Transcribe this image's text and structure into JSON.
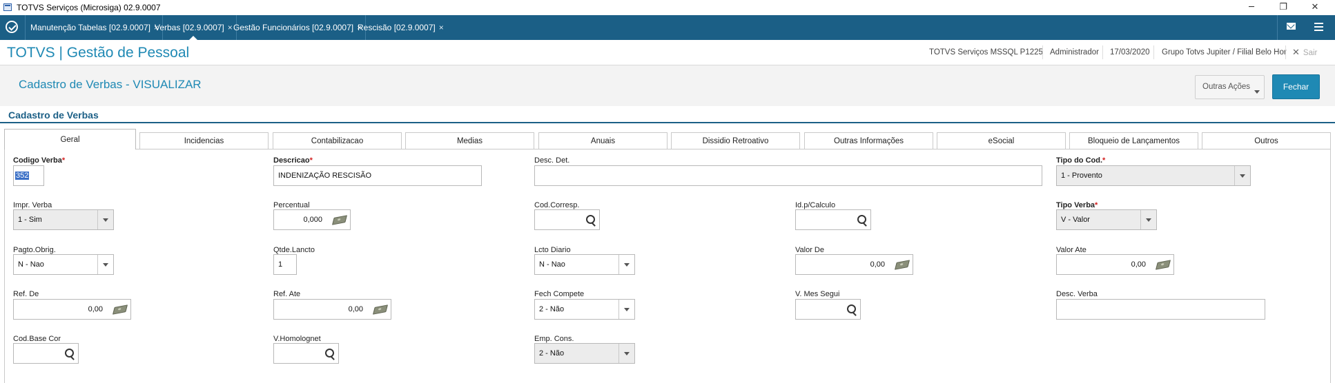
{
  "window": {
    "title": "TOTVS Serviços (Microsiga) 02.9.0007",
    "minimize": "─",
    "maximize": "❐",
    "close": "✕"
  },
  "tabs": [
    {
      "label": "Manutenção Tabelas [02.9.0007]",
      "close": "×"
    },
    {
      "label": "Verbas [02.9.0007]",
      "close": "×"
    },
    {
      "label": "Gestão Funcionários [02.9.0007]",
      "close": "×"
    },
    {
      "label": "Rescisão [02.9.0007]",
      "close": "×"
    }
  ],
  "header": {
    "brand": "TOTVS | Gestão de Pessoal",
    "environment": "TOTVS Serviços MSSQL P1225",
    "user": "Administrador",
    "date": "17/03/2020",
    "branch": "Grupo Totvs Jupiter / Filial Belo Hor",
    "exit_icon": "✕",
    "exit": "Sair"
  },
  "page": {
    "title": "Cadastro de Verbas - VISUALIZAR",
    "other_actions": "Outras Ações",
    "close": "Fechar",
    "section": "Cadastro de Verbas"
  },
  "folders": [
    "Geral",
    "Incidencias",
    "Contabilizacao",
    "Medias",
    "Anuais",
    "Dissidio Retroativo",
    "Outras Informações",
    "eSocial",
    "Bloqueio de Lançamentos",
    "Outros"
  ],
  "fields": {
    "codigo_verba": {
      "label": "Codigo Verba",
      "value": "352"
    },
    "descricao": {
      "label": "Descricao",
      "value": "INDENIZAÇÃO RESCISÃO"
    },
    "desc_det": {
      "label": "Desc. Det.",
      "value": ""
    },
    "tipo_cod": {
      "label": "Tipo do Cod.",
      "value": "1 - Provento"
    },
    "impr_verba": {
      "label": "Impr. Verba",
      "value": "1 - Sim"
    },
    "percentual": {
      "label": "Percentual",
      "value": "0,000"
    },
    "cod_corresp": {
      "label": "Cod.Corresp.",
      "value": ""
    },
    "id_calculo": {
      "label": "Id.p/Calculo",
      "value": ""
    },
    "tipo_verba": {
      "label": "Tipo Verba",
      "value": "V - Valor"
    },
    "pagto_obrig": {
      "label": "Pagto.Obrig.",
      "value": "N - Nao"
    },
    "qtde_lancto": {
      "label": "Qtde.Lancto",
      "value": "1"
    },
    "lcto_diario": {
      "label": "Lcto Diario",
      "value": "N - Nao"
    },
    "valor_de": {
      "label": "Valor De",
      "value": "0,00"
    },
    "valor_ate": {
      "label": "Valor Ate",
      "value": "0,00"
    },
    "ref_de": {
      "label": "Ref. De",
      "value": "0,00"
    },
    "ref_ate": {
      "label": "Ref. Ate",
      "value": "0,00"
    },
    "fech_compete": {
      "label": "Fech Compete",
      "value": "2 - Não"
    },
    "v_mes_segui": {
      "label": "V. Mes Segui",
      "value": ""
    },
    "desc_verba": {
      "label": "Desc. Verba",
      "value": ""
    },
    "cod_base_cor": {
      "label": "Cod.Base Cor",
      "value": ""
    },
    "v_homolognet": {
      "label": "V.Homolognet",
      "value": ""
    },
    "emp_cons": {
      "label": "Emp. Cons.",
      "value": "2 - Não"
    }
  }
}
